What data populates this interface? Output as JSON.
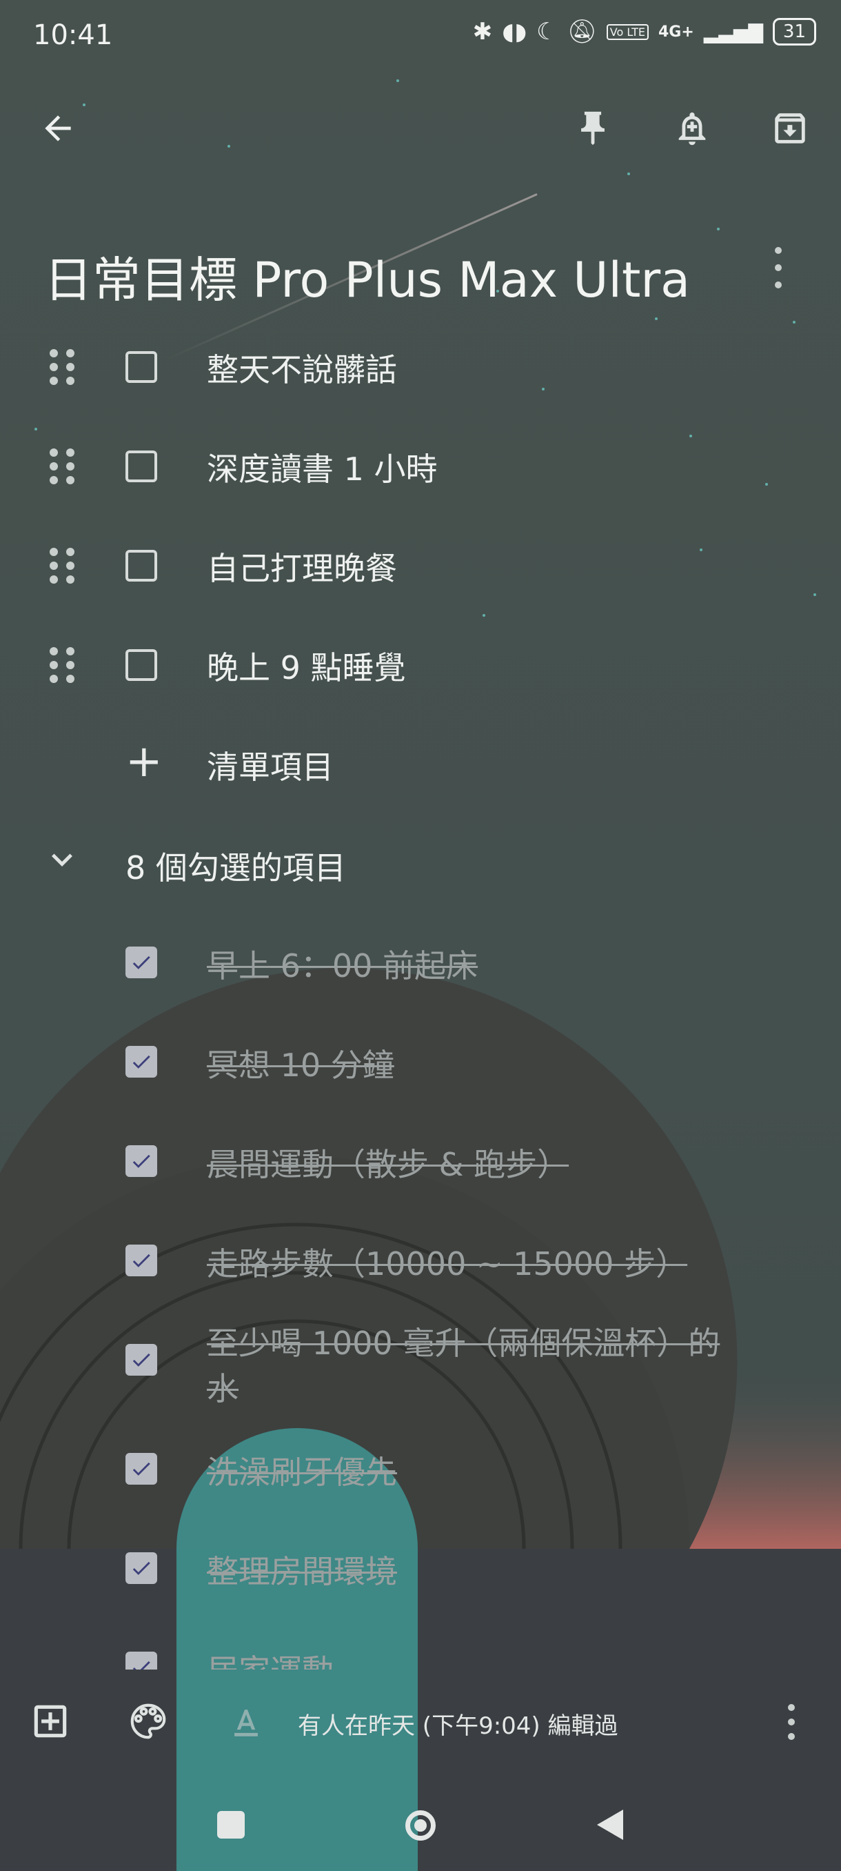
{
  "status_bar": {
    "time": "10:41",
    "network": "4G+",
    "volte": "Vo LTE",
    "battery": "31",
    "icons": [
      "bluetooth-icon",
      "earbuds-icon",
      "moon-icon",
      "bell-off-icon",
      "signal-icon"
    ]
  },
  "toolbar": {
    "back_icon": "arrow-left-icon",
    "pin_icon": "pin-icon",
    "reminder_icon": "bell-plus-icon",
    "archive_icon": "archive-icon"
  },
  "note": {
    "title": "日常目標 Pro Plus Max Ultra",
    "unchecked_items": [
      {
        "label": "整天不說髒話"
      },
      {
        "label": "深度讀書 1 小時"
      },
      {
        "label": "自己打理晚餐"
      },
      {
        "label": "晚上 9 點睡覺"
      }
    ],
    "add_item_label": "清單項目",
    "checked_section_label": "8 個勾選的項目",
    "checked_items": [
      {
        "label": "早上 6：00 前起床"
      },
      {
        "label": "冥想 10 分鐘"
      },
      {
        "label": "晨間運動（散步 & 跑步）"
      },
      {
        "label": "走路步數（10000 ~ 15000 步）"
      },
      {
        "label": "至少喝 1000 毫升（兩個保溫杯）的水"
      },
      {
        "label": "洗澡刷牙優先"
      },
      {
        "label": "整理房間環境"
      },
      {
        "label": "居家運動"
      }
    ]
  },
  "bottom_bar": {
    "edited_text": "有人在昨天 (下午9:04) 編輯過",
    "add_icon": "add-box-icon",
    "palette_icon": "palette-icon",
    "text_format_icon": "text-format-icon",
    "more_icon": "more-vert-icon"
  },
  "nav_bar": {
    "icons": [
      "recents-square-icon",
      "home-circle-icon",
      "back-triangle-icon"
    ]
  },
  "colors": {
    "background": "#46514f",
    "checkmark": "#3c3f7a",
    "teal_shape": "#3f8e8c",
    "sunset": "#b0655f",
    "bottom_panel": "#3b3f43"
  }
}
